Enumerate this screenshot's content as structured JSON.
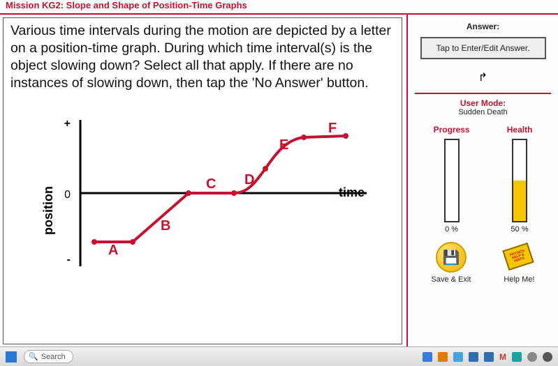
{
  "mission_title": "Mission KG2: Slope and Shape of Position-Time Graphs",
  "question": "Various time intervals during the motion are depicted by a letter on a position-time graph. During which time interval(s) is the object slowing down? Select all that apply. If there are no instances of slowing down, then tap the 'No Answer' button.",
  "graph": {
    "y_label": "position",
    "x_label": "time",
    "y_plus": "+",
    "y_zero": "0",
    "y_minus": "-",
    "segments": [
      "A",
      "B",
      "C",
      "D",
      "E",
      "F"
    ]
  },
  "sidebar": {
    "answer_label": "Answer:",
    "answer_placeholder": "Tap to Enter/Edit Answer.",
    "user_mode_label": "User Mode:",
    "user_mode_value": "Sudden Death",
    "progress": {
      "title": "Progress",
      "pct": 0,
      "pct_label": "0 %"
    },
    "health": {
      "title": "Health",
      "pct": 50,
      "pct_label": "50 %"
    },
    "save_label": "Save & Exit",
    "help_label": "Help Me!",
    "help_book_text": "PHYSICS HELP & HINTS"
  },
  "taskbar": {
    "search": "Search"
  },
  "chart_data": {
    "type": "line",
    "title": "",
    "xlabel": "time",
    "ylabel": "position",
    "ylim": [
      -1,
      1
    ],
    "segments": [
      {
        "name": "A",
        "desc": "flat negative position",
        "points": [
          [
            0.05,
            -0.6
          ],
          [
            0.18,
            -0.6
          ]
        ]
      },
      {
        "name": "B",
        "desc": "rising straight to zero",
        "points": [
          [
            0.18,
            -0.6
          ],
          [
            0.38,
            0.0
          ]
        ]
      },
      {
        "name": "C",
        "desc": "flat at zero",
        "points": [
          [
            0.38,
            0.0
          ],
          [
            0.55,
            0.0
          ]
        ]
      },
      {
        "name": "D",
        "desc": "concave-up rising",
        "points": [
          [
            0.55,
            0.0
          ],
          [
            0.66,
            0.28
          ]
        ]
      },
      {
        "name": "E",
        "desc": "concave-down rising",
        "points": [
          [
            0.66,
            0.28
          ],
          [
            0.8,
            0.68
          ]
        ]
      },
      {
        "name": "F",
        "desc": "flat high positive",
        "points": [
          [
            0.8,
            0.68
          ],
          [
            0.95,
            0.7
          ]
        ]
      }
    ]
  }
}
